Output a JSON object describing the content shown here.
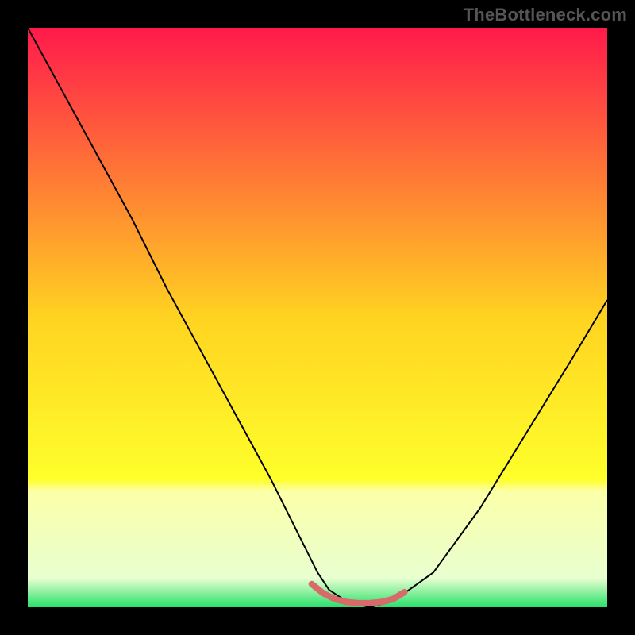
{
  "watermark": "TheBottleneck.com",
  "chart_data": {
    "type": "line",
    "title": "",
    "xlabel": "",
    "ylabel": "",
    "xlim": [
      0,
      100
    ],
    "ylim": [
      0,
      100
    ],
    "grid": false,
    "legend": false,
    "background_gradient": {
      "stops": [
        {
          "offset": 0.0,
          "color": "#ff1a4b"
        },
        {
          "offset": 0.5,
          "color": "#ffd321"
        },
        {
          "offset": 0.78,
          "color": "#feff2b"
        },
        {
          "offset": 0.8,
          "color": "#fbffa8"
        },
        {
          "offset": 0.95,
          "color": "#e8ffd0"
        },
        {
          "offset": 1.0,
          "color": "#29e06a"
        }
      ]
    },
    "series": [
      {
        "name": "bottleneck-curve",
        "color": "#000000",
        "width": 2,
        "x": [
          0,
          6,
          12,
          18,
          24,
          30,
          36,
          42,
          47,
          50,
          52,
          55,
          59,
          63,
          70,
          78,
          86,
          94,
          100
        ],
        "y": [
          100,
          89,
          78,
          67,
          55,
          44,
          33,
          22,
          12,
          6,
          3,
          1,
          0,
          1,
          6,
          17,
          30,
          43,
          53
        ]
      },
      {
        "name": "optimal-band",
        "color": "#d86a6a",
        "width": 8,
        "linecap": "round",
        "x": [
          49,
          51,
          53,
          55,
          57,
          59,
          61,
          63,
          65
        ],
        "y": [
          4,
          2.4,
          1.4,
          0.9,
          0.7,
          0.7,
          0.9,
          1.4,
          2.6
        ]
      }
    ]
  }
}
